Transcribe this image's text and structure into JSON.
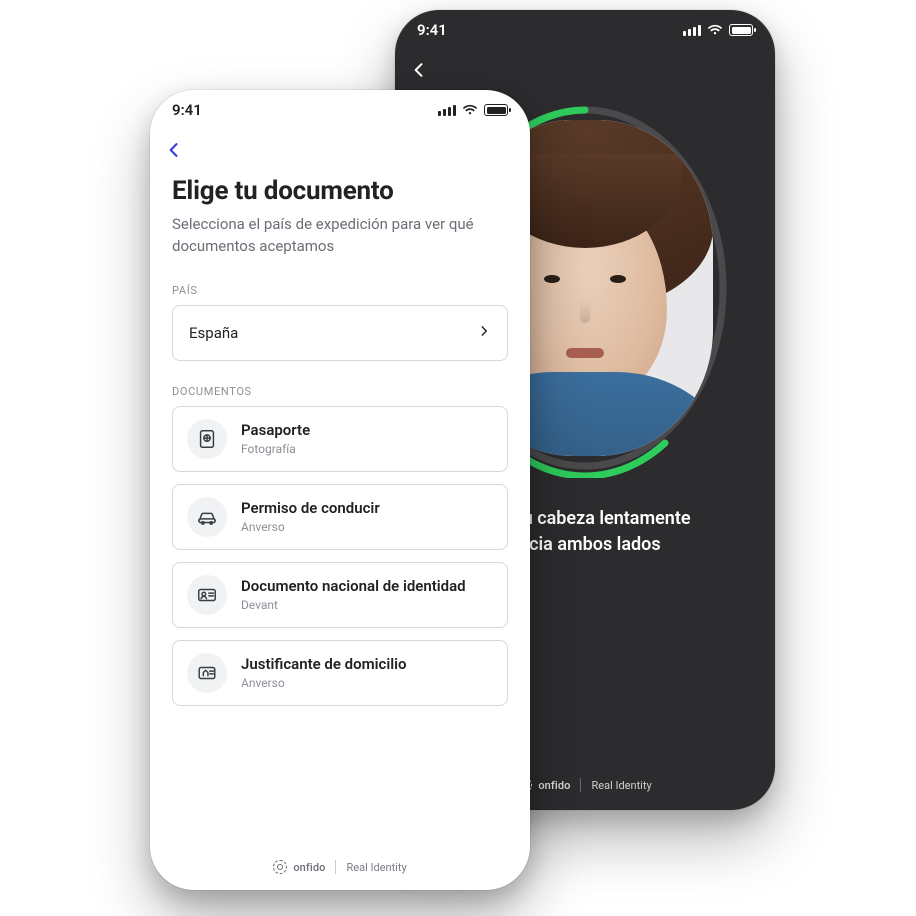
{
  "status": {
    "time": "9:41"
  },
  "light": {
    "heading": "Elige tu documento",
    "subheading": "Selecciona el país de expedición para ver qué documentos aceptamos",
    "country_label": "PAÍS",
    "country_value": "España",
    "documents_label": "DOCUMENTOS",
    "documents": [
      {
        "title": "Pasaporte",
        "subtitle": "Fotografía",
        "icon": "passport-icon"
      },
      {
        "title": "Permiso de conducir",
        "subtitle": "Anverso",
        "icon": "car-icon"
      },
      {
        "title": "Documento nacional de identidad",
        "subtitle": "Devant",
        "icon": "id-card-icon"
      },
      {
        "title": "Justificante de domicilio",
        "subtitle": "Anverso",
        "icon": "home-doc-icon"
      }
    ]
  },
  "dark": {
    "instruction_line1": "Gira tu cabeza lentamente",
    "instruction_line2": "hacia ambos lados"
  },
  "brand": {
    "name": "onfido",
    "tagline": "Real Identity"
  },
  "colors": {
    "accent": "#3b3ce8",
    "progress": "#2ecc5a"
  }
}
